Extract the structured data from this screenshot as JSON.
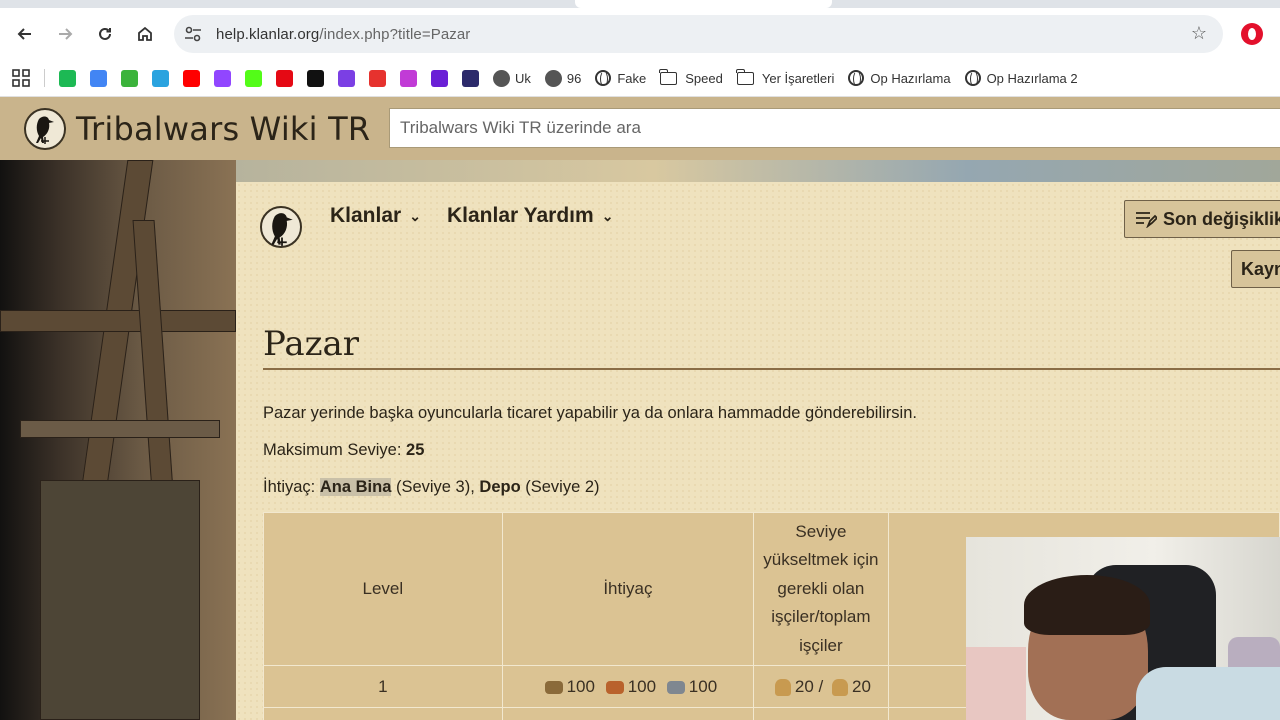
{
  "browser": {
    "url_host": "help.klanlar.org",
    "url_path": "/index.php?title=Pazar",
    "bookmarks": [
      {
        "label": "",
        "icon": "r-extension-icon",
        "color": "#1db954"
      },
      {
        "label": "",
        "icon": "translate-icon",
        "color": "#4285f4"
      },
      {
        "label": "",
        "icon": "green-circle-icon",
        "color": "#3bb33b"
      },
      {
        "label": "",
        "icon": "telegram-icon",
        "color": "#2aa3df"
      },
      {
        "label": "",
        "icon": "youtube-icon",
        "color": "#ff0000"
      },
      {
        "label": "",
        "icon": "twitch-icon",
        "color": "#9146ff"
      },
      {
        "label": "",
        "icon": "kick-icon",
        "color": "#53fc18"
      },
      {
        "label": "",
        "icon": "netflix-icon",
        "color": "#e50914"
      },
      {
        "label": "",
        "icon": "notion-icon",
        "color": "#111111"
      },
      {
        "label": "",
        "icon": "purple-app-icon",
        "color": "#7b3fe4"
      },
      {
        "label": "",
        "icon": "colorful-app-icon",
        "color": "#e6322e"
      },
      {
        "label": "",
        "icon": "c-app-icon",
        "color": "#c13bd6"
      },
      {
        "label": "",
        "icon": "play-icon",
        "color": "#6a1fd6"
      },
      {
        "label": "",
        "icon": "crown-icon",
        "color": "#2c2a6b"
      },
      {
        "label": "Uk",
        "icon": "tribalwars-icon",
        "color": "#555555"
      },
      {
        "label": "96",
        "icon": "tribalwars-icon",
        "color": "#555555"
      },
      {
        "label": "Fake",
        "icon": "globe-icon",
        "color": "#333333"
      },
      {
        "label": "Speed",
        "icon": "folder-icon",
        "color": "#333333"
      },
      {
        "label": "Yer İşaretleri",
        "icon": "folder-icon",
        "color": "#333333"
      },
      {
        "label": "Op Hazırlama",
        "icon": "globe-icon",
        "color": "#333333"
      },
      {
        "label": "Op Hazırlama 2",
        "icon": "globe-icon",
        "color": "#333333"
      }
    ]
  },
  "wiki": {
    "site_title": "Tribalwars Wiki TR",
    "search_placeholder": "Tribalwars Wiki TR üzerinde ara",
    "nav": {
      "menu1": "Klanlar",
      "menu2": "Klanlar Yardım",
      "recent_changes": "Son değişiklik",
      "source_btn": "Kayn"
    },
    "page_title": "Pazar",
    "intro": "Pazar yerinde başka oyuncularla ticaret yapabilir ya da onlara hammadde gönderebilirsin.",
    "max_level_label": "Maksimum Seviye: ",
    "max_level_value": "25",
    "req_label": "İhtiyaç: ",
    "req1_name": "Ana Bina",
    "req1_level": " (Seviye 3), ",
    "req2_name": "Depo",
    "req2_level": " (Seviye 2)",
    "table": {
      "headers": [
        "Level",
        "İhtiyaç",
        "Seviye yükseltmek için gerekli olan işçiler/toplam işçiler"
      ],
      "rows": [
        {
          "level": "1",
          "wood": "100",
          "clay": "100",
          "iron": "100",
          "workers": "20",
          "total_workers": "20",
          "sep": "/"
        }
      ]
    }
  }
}
